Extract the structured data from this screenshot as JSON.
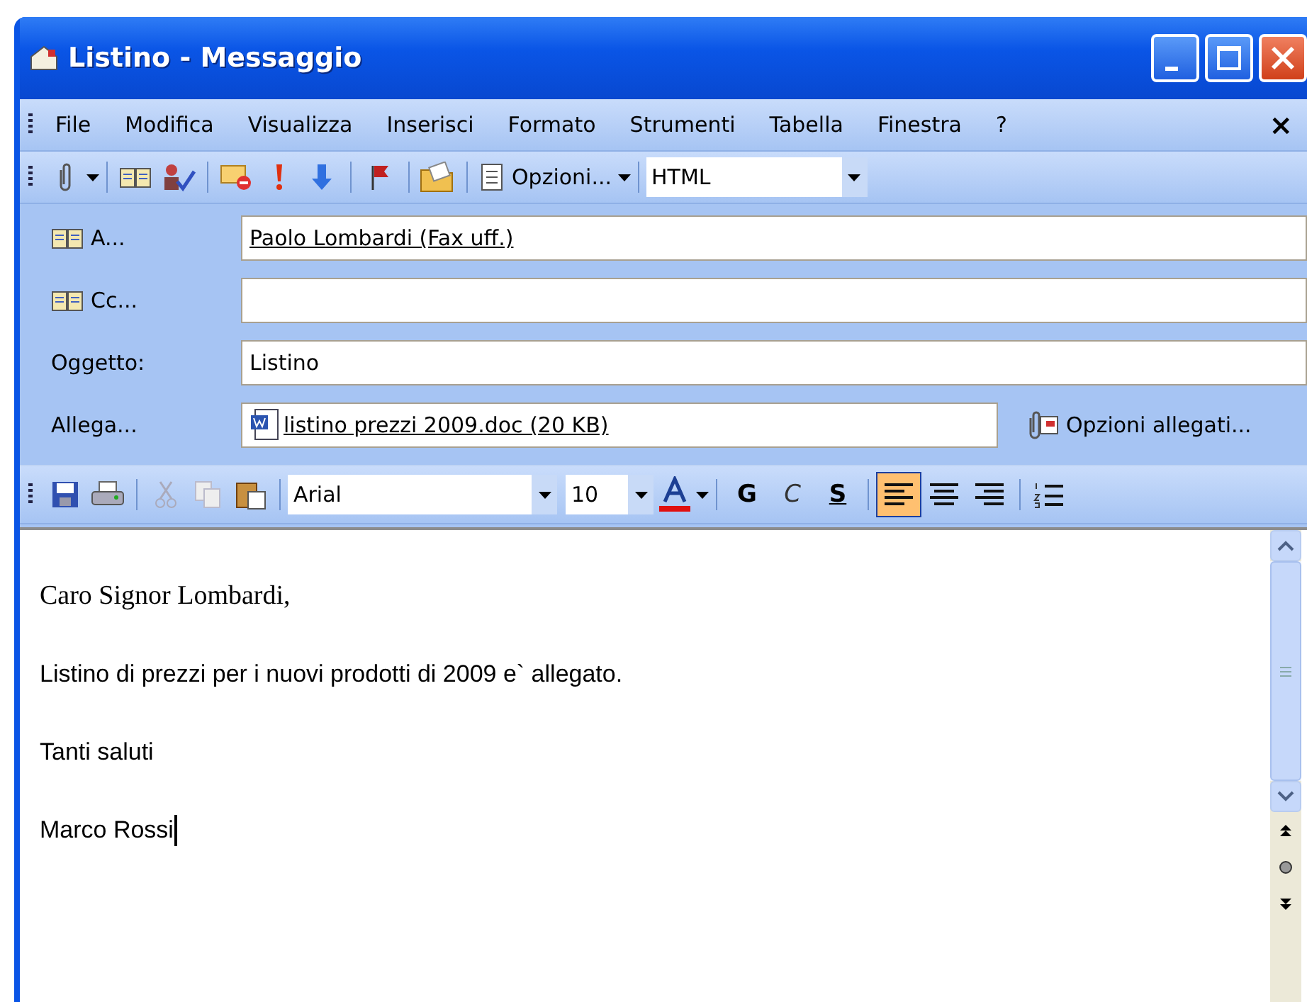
{
  "window": {
    "title": "Listino - Messaggio"
  },
  "menu": [
    "File",
    "Modifica",
    "Visualizza",
    "Inserisci",
    "Formato",
    "Strumenti",
    "Tabella",
    "Finestra",
    "?"
  ],
  "menu_close": "×",
  "toolbar": {
    "options_label": "Opzioni...",
    "format_value": "HTML"
  },
  "header": [
    {
      "kind": "book",
      "label": "A...",
      "value": "Paolo Lombardi (Fax uff.)"
    },
    {
      "kind": "book",
      "label": "Cc..."
    },
    {
      "kind": "plain",
      "label": "Oggetto:",
      "value": "Listino"
    },
    {
      "kind": "attach",
      "label": "Allega...",
      "value": "listino prezzi 2009.doc (20 KB)",
      "options": "Opzioni allegati..."
    }
  ],
  "format_toolbar": {
    "font": "Arial",
    "size": "10",
    "bold": "G",
    "italic": "C",
    "underline": "S",
    "align": [
      {
        "selected": true
      },
      {
        "selected": false
      },
      {
        "selected": false
      }
    ]
  },
  "body": [
    {
      "kind": "serif",
      "text": "Caro Signor Lombardi,"
    },
    {
      "kind": "sans",
      "text": "Listino di prezzi per i nuovi prodotti di 2009 e` allegato."
    },
    {
      "kind": "sans",
      "text": "Tanti saluti"
    },
    {
      "kind": "sans",
      "text": "Marco Rossi",
      "caret": true
    }
  ]
}
